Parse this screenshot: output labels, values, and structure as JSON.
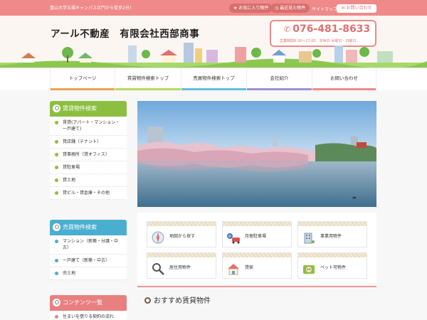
{
  "topbar": {
    "tagline": "富山大学五福キャンパス正門から徒歩2分！",
    "favorites_label": "お気に入り物件",
    "recent_label": "最近見た物件",
    "sitemap_label": "サイトマップ",
    "contact_label": "お問い合わせ"
  },
  "header": {
    "site_title": "アール不動産　有限会社西部商事",
    "phone": "076-481-8633",
    "hours": "営業時間9:30～17:00　定休日:水曜日・日曜日"
  },
  "nav": {
    "items": [
      {
        "label": "トップページ",
        "color": "#f0a050"
      },
      {
        "label": "賃貸物件検索トップ",
        "color": "#b8d860"
      },
      {
        "label": "売買物件検索トップ",
        "color": "#60c0d8"
      },
      {
        "label": "会社紹介",
        "color": "#a090d0"
      },
      {
        "label": "お問い合わせ",
        "color": "#f08a8a"
      }
    ]
  },
  "sidebar": {
    "rental": {
      "title": "賃貸物件検索",
      "color": "#8cbf3f",
      "items": [
        "賃貸(アパート・マンション・一戸建て)",
        "貸店舗（テナント）",
        "貸事務所（貸オフィス）",
        "貸駐車場",
        "貸土地",
        "貸ビル・貸倉庫・その他"
      ]
    },
    "sale": {
      "title": "売買物件検索",
      "color": "#4aaed0",
      "items": [
        "マンション（新築・分譲・中古）",
        "一戸建て（新築・中古）",
        "売土地"
      ]
    },
    "contents": {
      "title": "コンテンツ一覧",
      "color": "#e98080",
      "items": [
        "住まいを借りる契約の流れ"
      ]
    }
  },
  "quick_links": [
    {
      "label": "地図から探す",
      "icon": "map-compass-icon"
    },
    {
      "label": "月極駐車場",
      "icon": "parking-car-icon"
    },
    {
      "label": "事業用物件",
      "icon": "office-building-icon"
    },
    {
      "label": "居住用物件",
      "icon": "magnifier-icon"
    },
    {
      "label": "貸家",
      "icon": "house-icon"
    },
    {
      "label": "ペット可物件",
      "icon": "pet-dog-icon"
    }
  ],
  "main": {
    "section_title": "おすすめ賃貸物件"
  }
}
